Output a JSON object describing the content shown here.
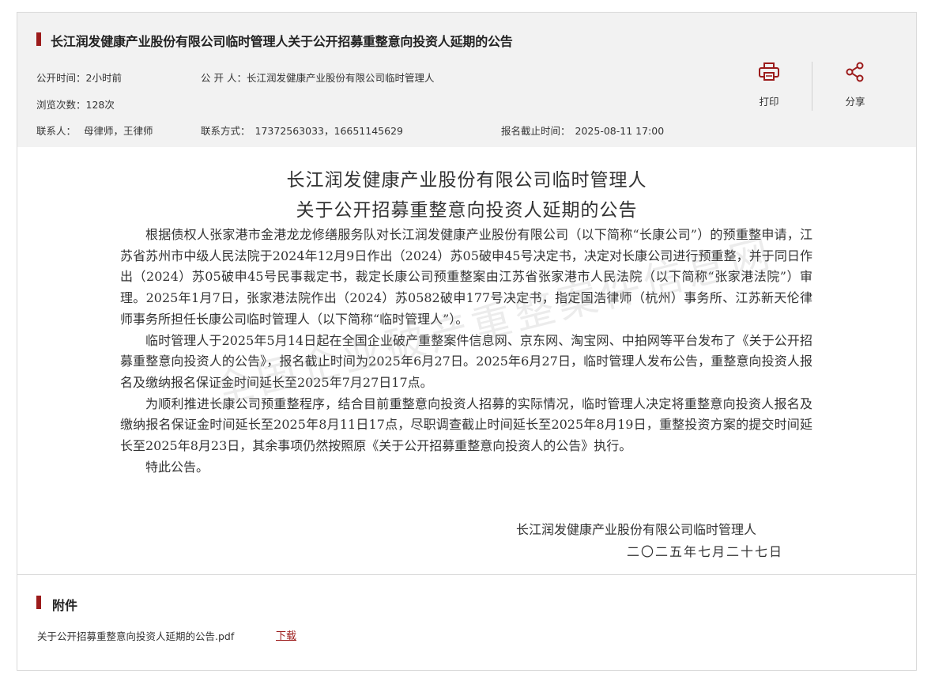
{
  "header": {
    "title": "长江润发健康产业股份有限公司临时管理人关于公开招募重整意向投资人延期的公告",
    "publish_time_label": "公开时间：",
    "publish_time": "2小时前",
    "publisher_label": "公 开 人：",
    "publisher": "长江润发健康产业股份有限公司临时管理人",
    "views_label": "浏览次数：",
    "views": "128次",
    "contact_label": "联系人：",
    "contact": "母律师，王律师",
    "phone_label": "联系方式：",
    "phone": "17372563033，16651145629",
    "deadline_label": "报名截止时间：",
    "deadline": "2025-08-11 17:00",
    "print_label": "打印",
    "share_label": "分享"
  },
  "document": {
    "title_line1": "长江润发健康产业股份有限公司临时管理人",
    "title_line2": "关于公开招募重整意向投资人延期的公告",
    "paragraphs": [
      "根据债权人张家港市金港龙龙修缮服务队对长江润发健康产业股份有限公司（以下简称“长康公司”）的预重整申请，江苏省苏州市中级人民法院于2024年12月9日作出（2024）苏05破申45号决定书，决定对长康公司进行预重整，并于同日作出（2024）苏05破申45号民事裁定书，裁定长康公司预重整案由江苏省张家港市人民法院（以下简称“张家港法院”）审理。2025年1月7日，张家港法院作出（2024）苏0582破申177号决定书，指定国浩律师（杭州）事务所、江苏新天伦律师事务所担任长康公司临时管理人（以下简称“临时管理人”）。",
      "临时管理人于2025年5月14日起在全国企业破产重整案件信息网、京东网、淘宝网、中拍网等平台发布了《关于公开招募重整意向投资人的公告》，报名截止时间为2025年6月27日。2025年6月27日，临时管理人发布公告，重整意向投资人报名及缴纳报名保证金时间延长至2025年7月27日17点。",
      "为顺利推进长康公司预重整程序，结合目前重整意向投资人招募的实际情况，临时管理人决定将重整意向投资人报名及缴纳报名保证金时间延长至2025年8月11日17点，尽职调查截止时间延长至2025年8月19日，重整投资方案的提交时间延长至2025年8月23日，其余事项仍然按照原《关于公开招募重整意向投资人的公告》执行。",
      "特此公告。"
    ],
    "signature": "长江润发健康产业股份有限公司临时管理人",
    "date": "二〇二五年七月二十七日",
    "watermark": "全国企业破产重整案件信息网"
  },
  "attachments": {
    "title": "附件",
    "file_name": "关于公开招募重整意向投资人延期的公告.pdf",
    "download_label": "下载"
  },
  "colors": {
    "accent": "#9c1b1b",
    "header_bg": "#f2f2f2"
  }
}
